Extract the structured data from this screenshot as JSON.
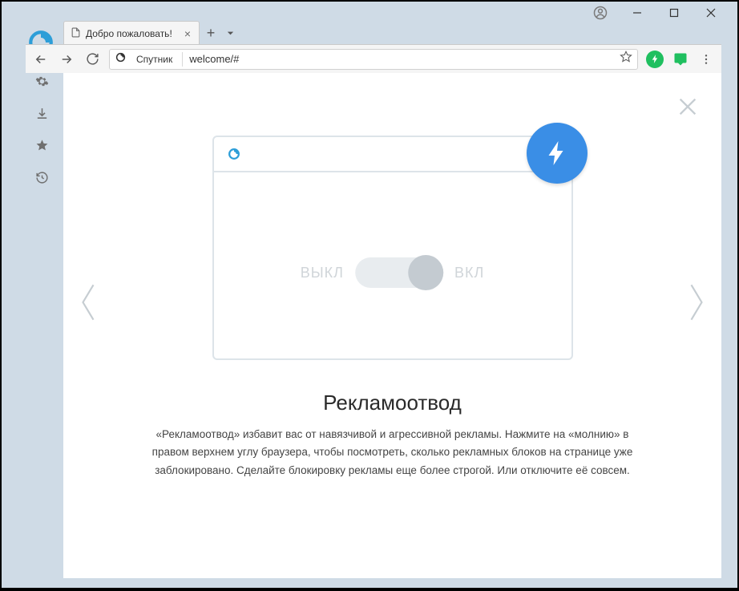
{
  "tab": {
    "title": "Добро пожаловать!"
  },
  "addressbar": {
    "engine_label": "Спутник",
    "url": "welcome/#"
  },
  "slide": {
    "off_label": "ВЫКЛ",
    "on_label": "ВКЛ",
    "heading": "Рекламоотвод",
    "description": "«Рекламоотвод» избавит вас от навязчивой и агрессивной рекламы. Нажмите на «молнию» в правом верхнем углу браузера, чтобы посмотреть, сколько рекламных блоков на странице уже заблокировано. Сделайте блокировку рекламы еще более строгой. Или отключите её совсем."
  },
  "colors": {
    "accent": "#3a8ee6",
    "extension": "#1fbf5f"
  }
}
